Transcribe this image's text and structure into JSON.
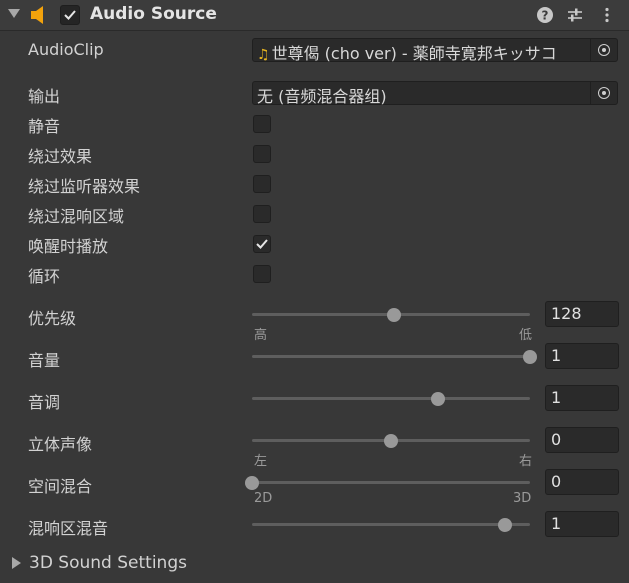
{
  "header": {
    "title": "Audio Source",
    "enabled": true,
    "icons": [
      "foldout-arrow-icon",
      "audio-source-speaker-icon",
      "help-icon",
      "preset-settings-icon",
      "more-options-icon"
    ]
  },
  "fields": {
    "audio_clip": {
      "label": "AudioClip",
      "value": "世尊偈 (cho ver) - 薬師寺寛邦キッサコ"
    },
    "output": {
      "label": "输出",
      "value": "无 (音频混合器组)"
    }
  },
  "toggles": [
    {
      "label": "静音",
      "checked": false
    },
    {
      "label": "绕过效果",
      "checked": false
    },
    {
      "label": "绕过监听器效果",
      "checked": false
    },
    {
      "label": "绕过混响区域",
      "checked": false
    },
    {
      "label": "唤醒时播放",
      "checked": true
    },
    {
      "label": "循环",
      "checked": false
    }
  ],
  "sliders": {
    "priority": {
      "label": "优先级",
      "value": "128",
      "fraction": 0.51,
      "min_label": "高",
      "max_label": "低"
    },
    "volume": {
      "label": "音量",
      "value": "1",
      "fraction": 1.0
    },
    "pitch": {
      "label": "音调",
      "value": "1",
      "fraction": 0.67
    },
    "stereo_pan": {
      "label": "立体声像",
      "value": "0",
      "fraction": 0.5,
      "min_label": "左",
      "max_label": "右"
    },
    "spatial_blend": {
      "label": "空间混合",
      "value": "0",
      "fraction": 0.0,
      "min_label": "2D",
      "max_label": "3D"
    },
    "reverb_zone_mix": {
      "label": "混响区混音",
      "value": "1",
      "fraction": 0.91
    }
  },
  "sound_settings": {
    "label": "3D Sound Settings",
    "expanded": false
  }
}
